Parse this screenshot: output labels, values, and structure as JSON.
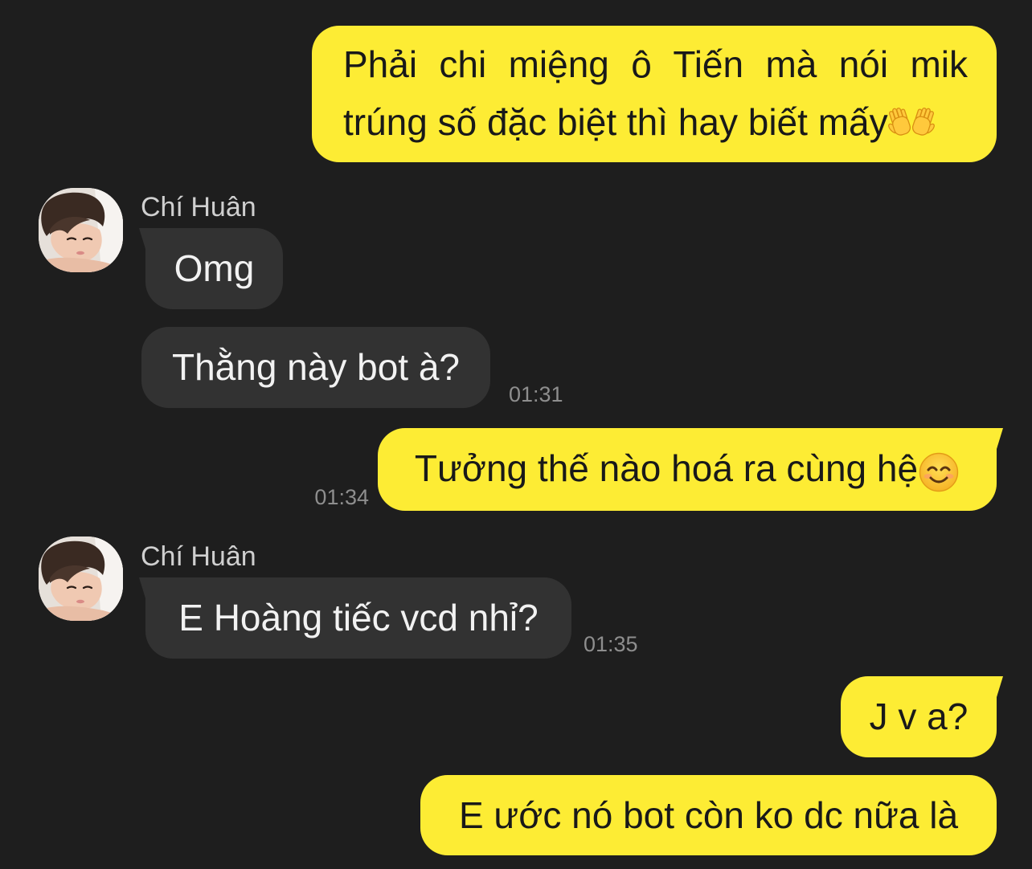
{
  "colors": {
    "background": "#1e1e1e",
    "outgoing_bubble": "#fdec34",
    "incoming_bubble": "#323232",
    "timestamp": "#8e8e8e",
    "sender_name": "#cfcfcf"
  },
  "groups": [
    {
      "is_outgoing": true,
      "messages": [
        {
          "text": "Phải chi miệng ô Tiến mà nói mik trúng số đặc biệt thì hay biết mấy",
          "emoji_icon": "open-hands-emoji"
        }
      ]
    },
    {
      "is_outgoing": false,
      "sender_name": "Chí Huân",
      "avatar_icon": "profile-photo-avatar",
      "messages": [
        {
          "text": "Omg"
        },
        {
          "text": "Thằng này bot à?",
          "time": "01:31"
        }
      ]
    },
    {
      "is_outgoing": true,
      "messages": [
        {
          "text": "Tưởng thế nào hoá ra cùng hệ",
          "emoji_icon": "smiling-face-with-smiling-eyes-emoji",
          "time": "01:34"
        }
      ]
    },
    {
      "is_outgoing": false,
      "sender_name": "Chí Huân",
      "avatar_icon": "profile-photo-avatar",
      "messages": [
        {
          "text": "E Hoàng tiếc vcd nhỉ?",
          "time": "01:35"
        }
      ]
    },
    {
      "is_outgoing": true,
      "messages": [
        {
          "text": "J v a?"
        },
        {
          "text": "E ước nó bot còn ko dc nữa là"
        }
      ]
    }
  ]
}
